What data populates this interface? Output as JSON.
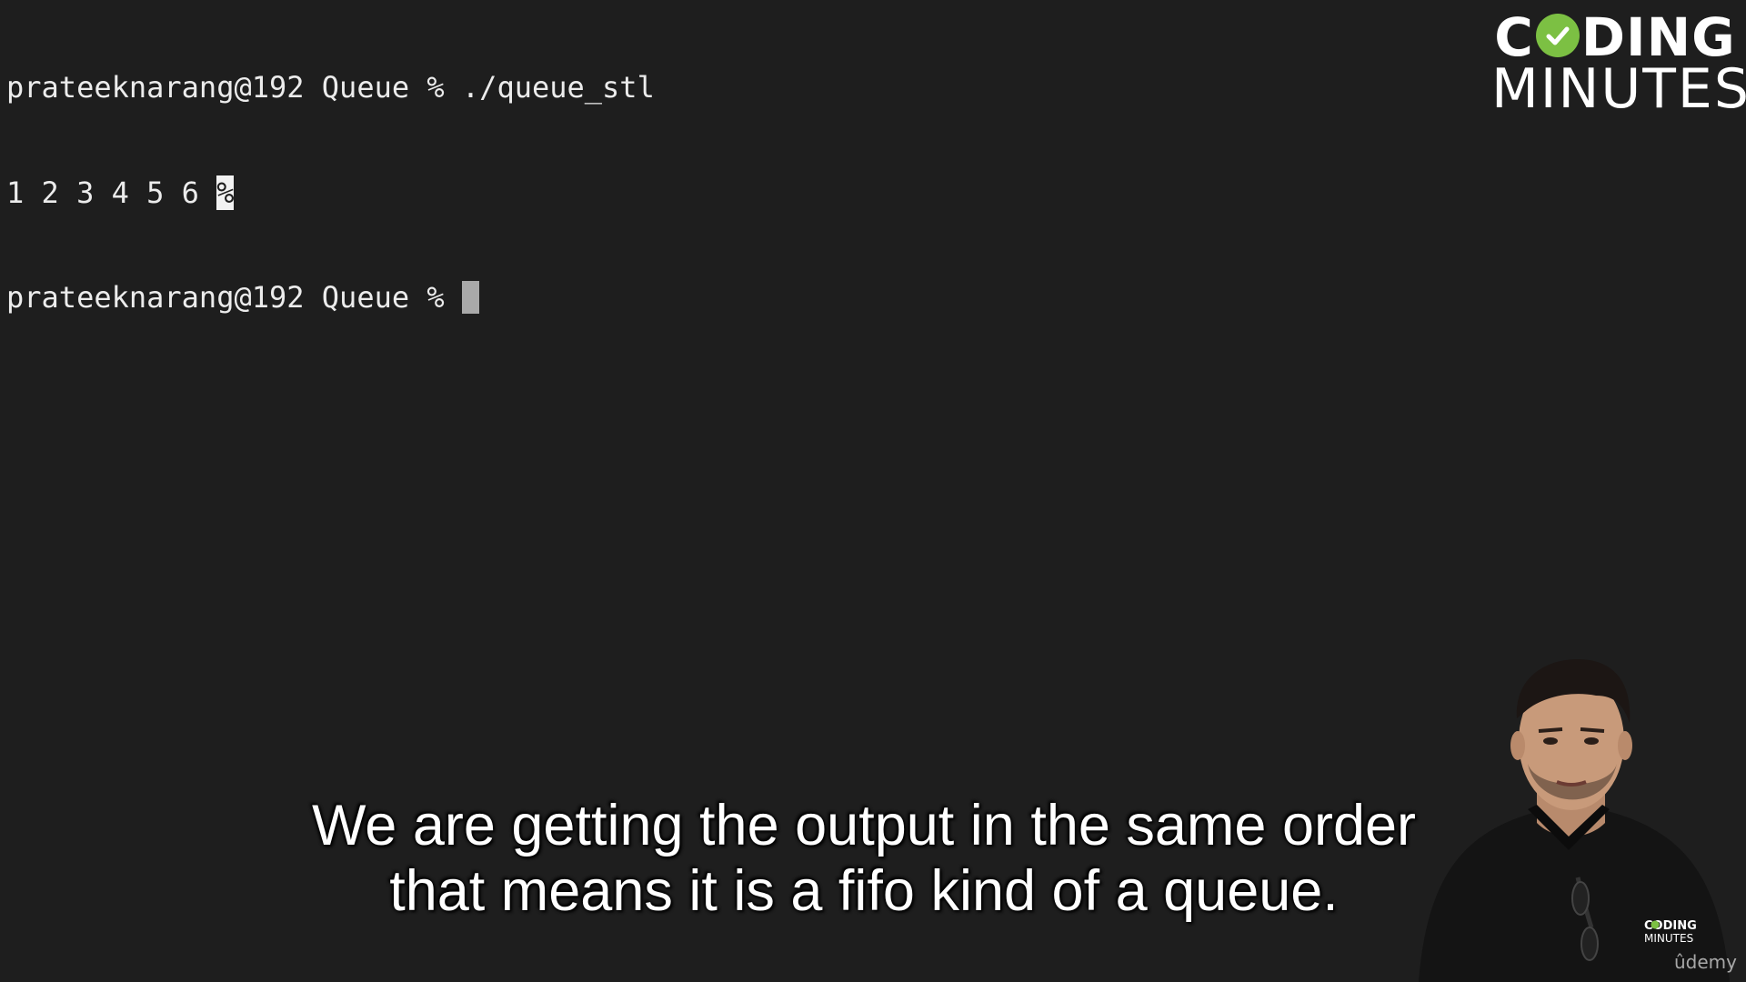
{
  "terminal": {
    "line1": "prateeknarang@192 Queue % ./queue_stl",
    "line2_output": "1 2 3 4 5 6 ",
    "line2_marker": "%",
    "line3_prompt": "prateeknarang@192 Queue % "
  },
  "logo": {
    "line1_start": "C",
    "line1_end": "DING",
    "line2": "MINUTES",
    "accent_color": "#7cc043",
    "icon": "check-icon"
  },
  "subtitle": {
    "line1": "We are getting the output in the same order",
    "line2": "that means it is a fifo kind of a queue."
  },
  "presenter": {
    "shirt_logo_line1": "CODING",
    "shirt_logo_line2": "MINUTES"
  },
  "watermark": "ûdemy",
  "colors": {
    "background": "#1e1e1e",
    "terminal_text": "#ececec",
    "cursor": "#a9a9a9"
  }
}
